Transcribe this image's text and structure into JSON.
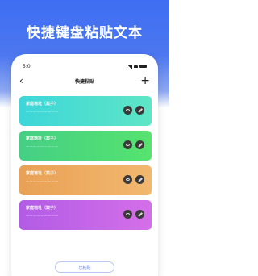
{
  "headline": "快捷键盘粘贴文本",
  "status_bar": {
    "time": "5:0"
  },
  "nav": {
    "back_icon": "‹",
    "title": "快捷粘贴",
    "add_icon": "+"
  },
  "cards": [
    {
      "title": "家庭地址（案子）",
      "text": "一一一一一一一一一",
      "color_start": "#3dd6d9",
      "color_end": "#5ee6c6"
    },
    {
      "title": "家庭地址（案子）",
      "text": "一一一一一一一一一",
      "color_start": "#45cf86",
      "color_end": "#56e36e"
    },
    {
      "title": "家庭地址（案子）",
      "text": "一一一一一一一一一",
      "color_start": "#e8a155",
      "color_end": "#f2b870"
    },
    {
      "title": "家庭地址（案子）",
      "text": "一一一一一一一一一",
      "color_start": "#b25ce6",
      "color_end": "#d46fe8"
    }
  ],
  "bottom_button": "已粘贴",
  "icons": {
    "view": "eye-icon",
    "edit": "pencil-icon"
  }
}
